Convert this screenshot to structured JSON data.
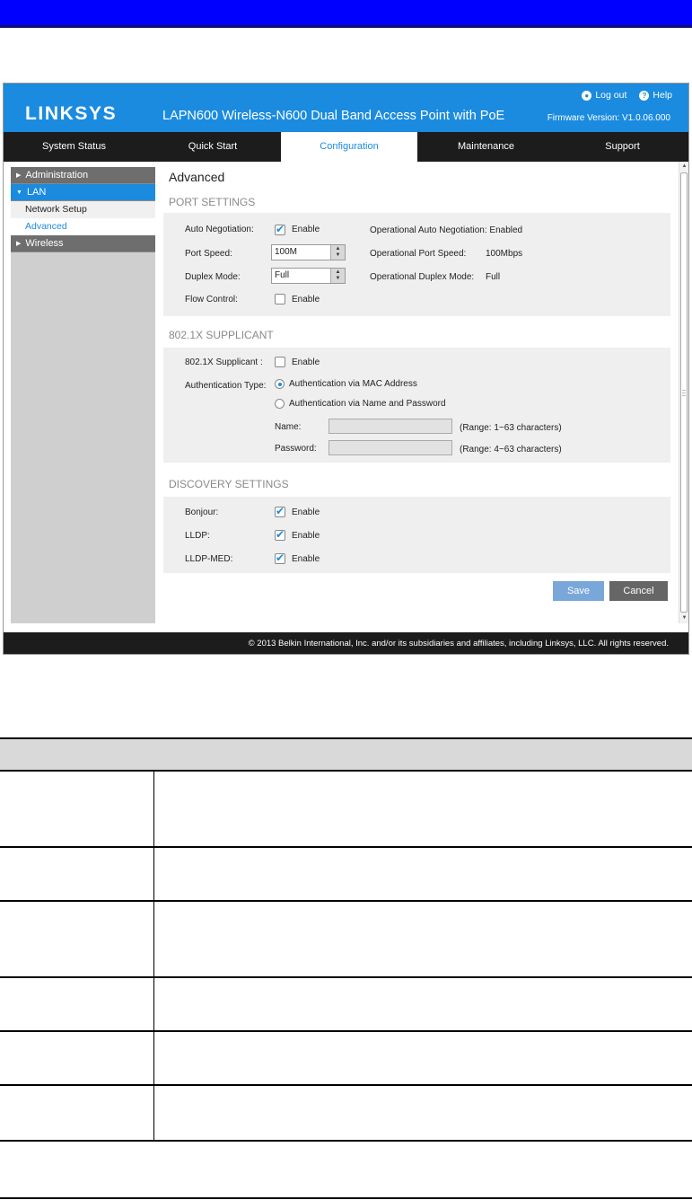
{
  "header": {
    "logo": "LINKSYS",
    "product": "LAPN600 Wireless-N600 Dual Band Access Point with PoE",
    "logout": "Log out",
    "help": "Help",
    "firmware": "Firmware Version: V1.0.06.000"
  },
  "nav": {
    "tabs": [
      "System Status",
      "Quick Start",
      "Configuration",
      "Maintenance",
      "Support"
    ],
    "active": "Configuration"
  },
  "sidebar": {
    "administration": "Administration",
    "lan": "LAN",
    "network_setup": "Network Setup",
    "advanced": "Advanced",
    "wireless": "Wireless"
  },
  "page": {
    "title": "Advanced",
    "port_settings": {
      "heading": "PORT SETTINGS",
      "auto_negotiation_label": "Auto Negotiation:",
      "auto_negotiation_checked": true,
      "enable": "Enable",
      "op_auto_neg": "Operational Auto Negotiation: Enabled",
      "port_speed_label": "Port Speed:",
      "port_speed_value": "100M",
      "op_port_speed_label": "Operational Port Speed:",
      "op_port_speed_value": "100Mbps",
      "duplex_label": "Duplex Mode:",
      "duplex_value": "Full",
      "op_duplex_label": "Operational Duplex Mode:",
      "op_duplex_value": "Full",
      "flow_control_label": "Flow Control:",
      "flow_control_checked": false
    },
    "supplicant": {
      "heading": "802.1X SUPPLICANT",
      "label": "802.1X Supplicant :",
      "checked": false,
      "enable": "Enable",
      "auth_type_label": "Authentication Type:",
      "auth_mac": "Authentication via MAC Address",
      "auth_name": "Authentication via Name and Password",
      "selected": "mac",
      "name_label": "Name:",
      "name_value": "",
      "name_range": "(Range: 1~63 characters)",
      "password_label": "Password:",
      "password_value": "",
      "password_range": "(Range: 4~63 characters)"
    },
    "discovery": {
      "heading": "DISCOVERY SETTINGS",
      "bonjour_label": "Bonjour:",
      "lldp_label": "LLDP:",
      "lldp_med_label": "LLDP-MED:",
      "enable": "Enable",
      "bonjour_checked": true,
      "lldp_checked": true,
      "lldp_med_checked": true
    },
    "buttons": {
      "save": "Save",
      "cancel": "Cancel"
    }
  },
  "footer": {
    "copyright": "© 2013 Belkin International, Inc. and/or its subsidiaries and affiliates, including Linksys, LLC. All rights reserved."
  },
  "colors": {
    "top_bar": "#0000ff",
    "linksys_blue": "#1b8be0",
    "nav_dark": "#1c1c1c"
  }
}
